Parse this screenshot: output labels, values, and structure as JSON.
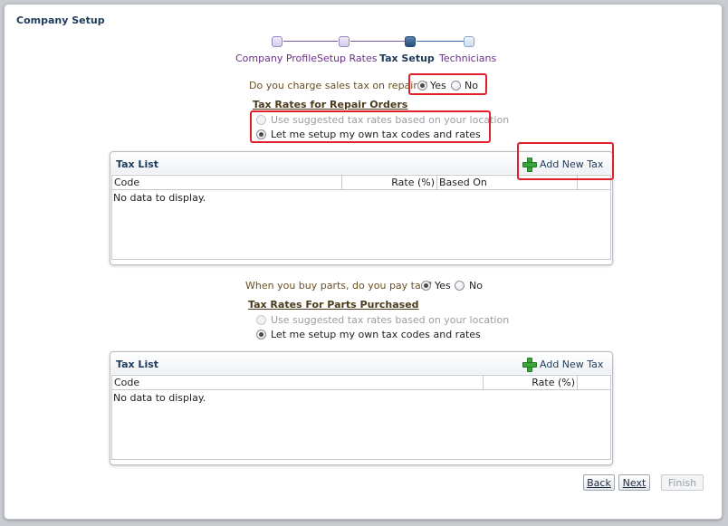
{
  "window": {
    "title": "Company Setup"
  },
  "train": {
    "steps": [
      {
        "label": "Company Profile",
        "state": "visited"
      },
      {
        "label": "Setup Rates",
        "state": "visited"
      },
      {
        "label": "Tax Setup",
        "state": "current"
      },
      {
        "label": "Technicians",
        "state": "future"
      }
    ]
  },
  "repairs": {
    "question": "Do you charge sales tax on repairs?",
    "yes_label": "Yes",
    "no_label": "No",
    "selected": "Yes",
    "section_title": "Tax Rates for Repair Orders",
    "option_suggested": "Use suggested tax rates based on your location",
    "option_own": "Let me setup my own tax codes and rates",
    "table": {
      "title": "Tax List",
      "add_label": "Add New Tax",
      "columns": [
        "Code",
        "Rate (%)",
        "Based On"
      ],
      "empty_message": "No data to display."
    }
  },
  "parts": {
    "question": "When you buy parts, do you pay tax?",
    "yes_label": "Yes",
    "no_label": "No",
    "selected": "Yes",
    "section_title": "Tax Rates For Parts Purchased",
    "option_suggested": "Use suggested tax rates based on your location",
    "option_own": "Let me setup my own tax codes and rates",
    "table": {
      "title": "Tax List",
      "add_label": "Add New Tax",
      "columns": [
        "Code",
        "Rate (%)"
      ],
      "empty_message": "No data to display."
    }
  },
  "buttons": {
    "back": "Back",
    "next": "Next",
    "finish": "Finish"
  },
  "colors": {
    "highlight": "#e0202a",
    "accent": "#1e3a5a",
    "visited": "#6b2f8a"
  }
}
